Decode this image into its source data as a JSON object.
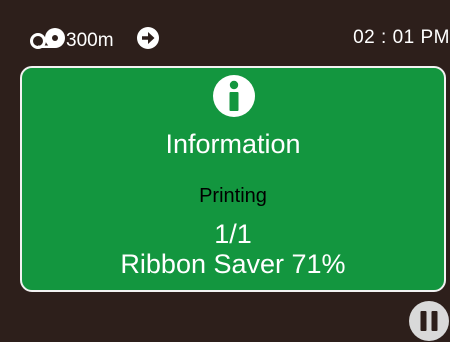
{
  "status_bar": {
    "ribbon_icon": "ribbon-roll-icon",
    "ribbon_length": "300m",
    "arrow_icon": "arrow-right-circle-icon",
    "time": "02 : 01 PM"
  },
  "panel": {
    "icon": "info-icon",
    "title": "Information",
    "status": "Printing",
    "page_count": "1/1",
    "ribbon_saver": "Ribbon Saver 71%"
  },
  "controls": {
    "pause_icon": "pause-icon"
  },
  "colors": {
    "background": "#2d1f1b",
    "panel": "#13963f",
    "panel_border": "#f2f2f2",
    "text": "#ffffff",
    "status_text": "#000000"
  }
}
